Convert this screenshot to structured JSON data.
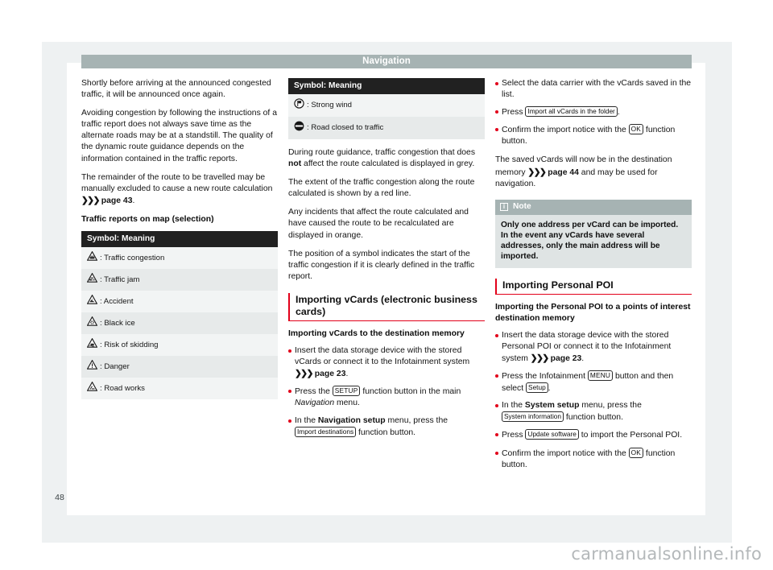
{
  "document": {
    "chapter_title": "Navigation",
    "page_number": "48",
    "watermark": "carmanualsonline.info"
  },
  "column_left": {
    "paragraph_1": "Shortly before arriving at the announced congested traffic, it will be announced once again.",
    "paragraph_2": "Avoiding congestion by following the instructions of a traffic report does not always save time as the alternate roads may be at a standstill. The quality of the dynamic route guidance depends on the information contained in the traffic reports.",
    "paragraph_3_pre": "The remainder of the route to be travelled may be manually excluded to cause a new route calculation ",
    "paragraph_3_ref": "page 43",
    "paragraph_3_post": ".",
    "subheading": "Traffic reports on map (selection)",
    "table": {
      "header": "Symbol: Meaning",
      "rows": [
        {
          "icon": "warning-triangle-traffic-congestion-icon",
          "label": ": Traffic congestion"
        },
        {
          "icon": "warning-triangle-traffic-jam-icon",
          "label": ": Traffic jam"
        },
        {
          "icon": "warning-triangle-accident-icon",
          "label": ": Accident"
        },
        {
          "icon": "warning-triangle-black-ice-icon",
          "label": ": Black ice"
        },
        {
          "icon": "warning-triangle-risk-of-skidding-icon",
          "label": ": Risk of skidding"
        },
        {
          "icon": "warning-triangle-danger-icon",
          "label": ": Danger"
        },
        {
          "icon": "warning-triangle-road-works-icon",
          "label": ": Road works"
        }
      ]
    }
  },
  "column_middle": {
    "table": {
      "header": "Symbol: Meaning",
      "rows": [
        {
          "icon": "circle-flag-strong-wind-icon",
          "label": ": Strong wind"
        },
        {
          "icon": "circle-bar-road-closed-icon",
          "label": ": Road closed to traffic"
        }
      ]
    },
    "paragraph_1_a": "During route guidance, traffic congestion that does ",
    "paragraph_1_bold": "not",
    "paragraph_1_b": " affect the route calculated is displayed in grey.",
    "paragraph_2": "The extent of the traffic congestion along the route calculated is shown by a red line.",
    "paragraph_3": "Any incidents that affect the route calculated and have caused the route to be recalculated are displayed in orange.",
    "paragraph_4": "The position of a symbol indicates the start of the traffic congestion if it is clearly defined in the traffic report.",
    "section_heading": "Importing vCards (electronic business cards)",
    "subheading": "Importing vCards to the destination memory",
    "bullets": [
      {
        "pre": "Insert the data storage device with the stored vCards or connect it to the Infotainment system ",
        "ref": "page 23",
        "post": "."
      },
      {
        "pre": "Press the ",
        "chip": "SETUP",
        "post_a": " function button in the main ",
        "italic": "Navigation",
        "post_b": " menu."
      },
      {
        "pre": "In the ",
        "bold": "Navigation setup",
        "mid": " menu, press the ",
        "chip": "Import destinations",
        "post": " function button."
      }
    ]
  },
  "column_right": {
    "bullets_top": [
      {
        "text": "Select the data carrier with the vCards saved in the list."
      },
      {
        "pre": "Press ",
        "chip": "Import all vCards in the folder",
        "post": "."
      },
      {
        "pre": "Confirm the import notice with the ",
        "chip": "OK",
        "post": " function button."
      }
    ],
    "paragraph_1_pre": "The saved vCards will now be in the destination memory ",
    "paragraph_1_ref": "page 44",
    "paragraph_1_post": " and may be used for navigation.",
    "note": {
      "icon": "info-icon",
      "title": "Note",
      "body": "Only one address per vCard can be imported. In the event any vCards have several addresses, only the main address will be imported."
    },
    "section_heading": "Importing Personal POI",
    "subheading": "Importing the Personal POI to a points of interest destination memory",
    "bullets": [
      {
        "pre": "Insert the data storage device with the stored Personal POI or connect it to the Infotainment system ",
        "ref": "page 23",
        "post": "."
      },
      {
        "pre": "Press the Infotainment ",
        "chip": "MENU",
        "mid": " button and then select ",
        "chip2": "Setup",
        "post": "."
      },
      {
        "pre": "In the ",
        "bold": "System setup",
        "mid": " menu, press the ",
        "chip": "System information",
        "post": " function button."
      },
      {
        "pre": "Press ",
        "chip": "Update software",
        "post": " to import the Personal POI."
      },
      {
        "pre": "Confirm the import notice with the ",
        "chip": "OK",
        "post": " function button."
      }
    ]
  },
  "colors": {
    "chapter_bar": "#a6b3b3",
    "accent_red": "#e2001a",
    "table_header": "#212121",
    "note_header": "#a6b3b3",
    "note_body": "#dfe4e4"
  }
}
